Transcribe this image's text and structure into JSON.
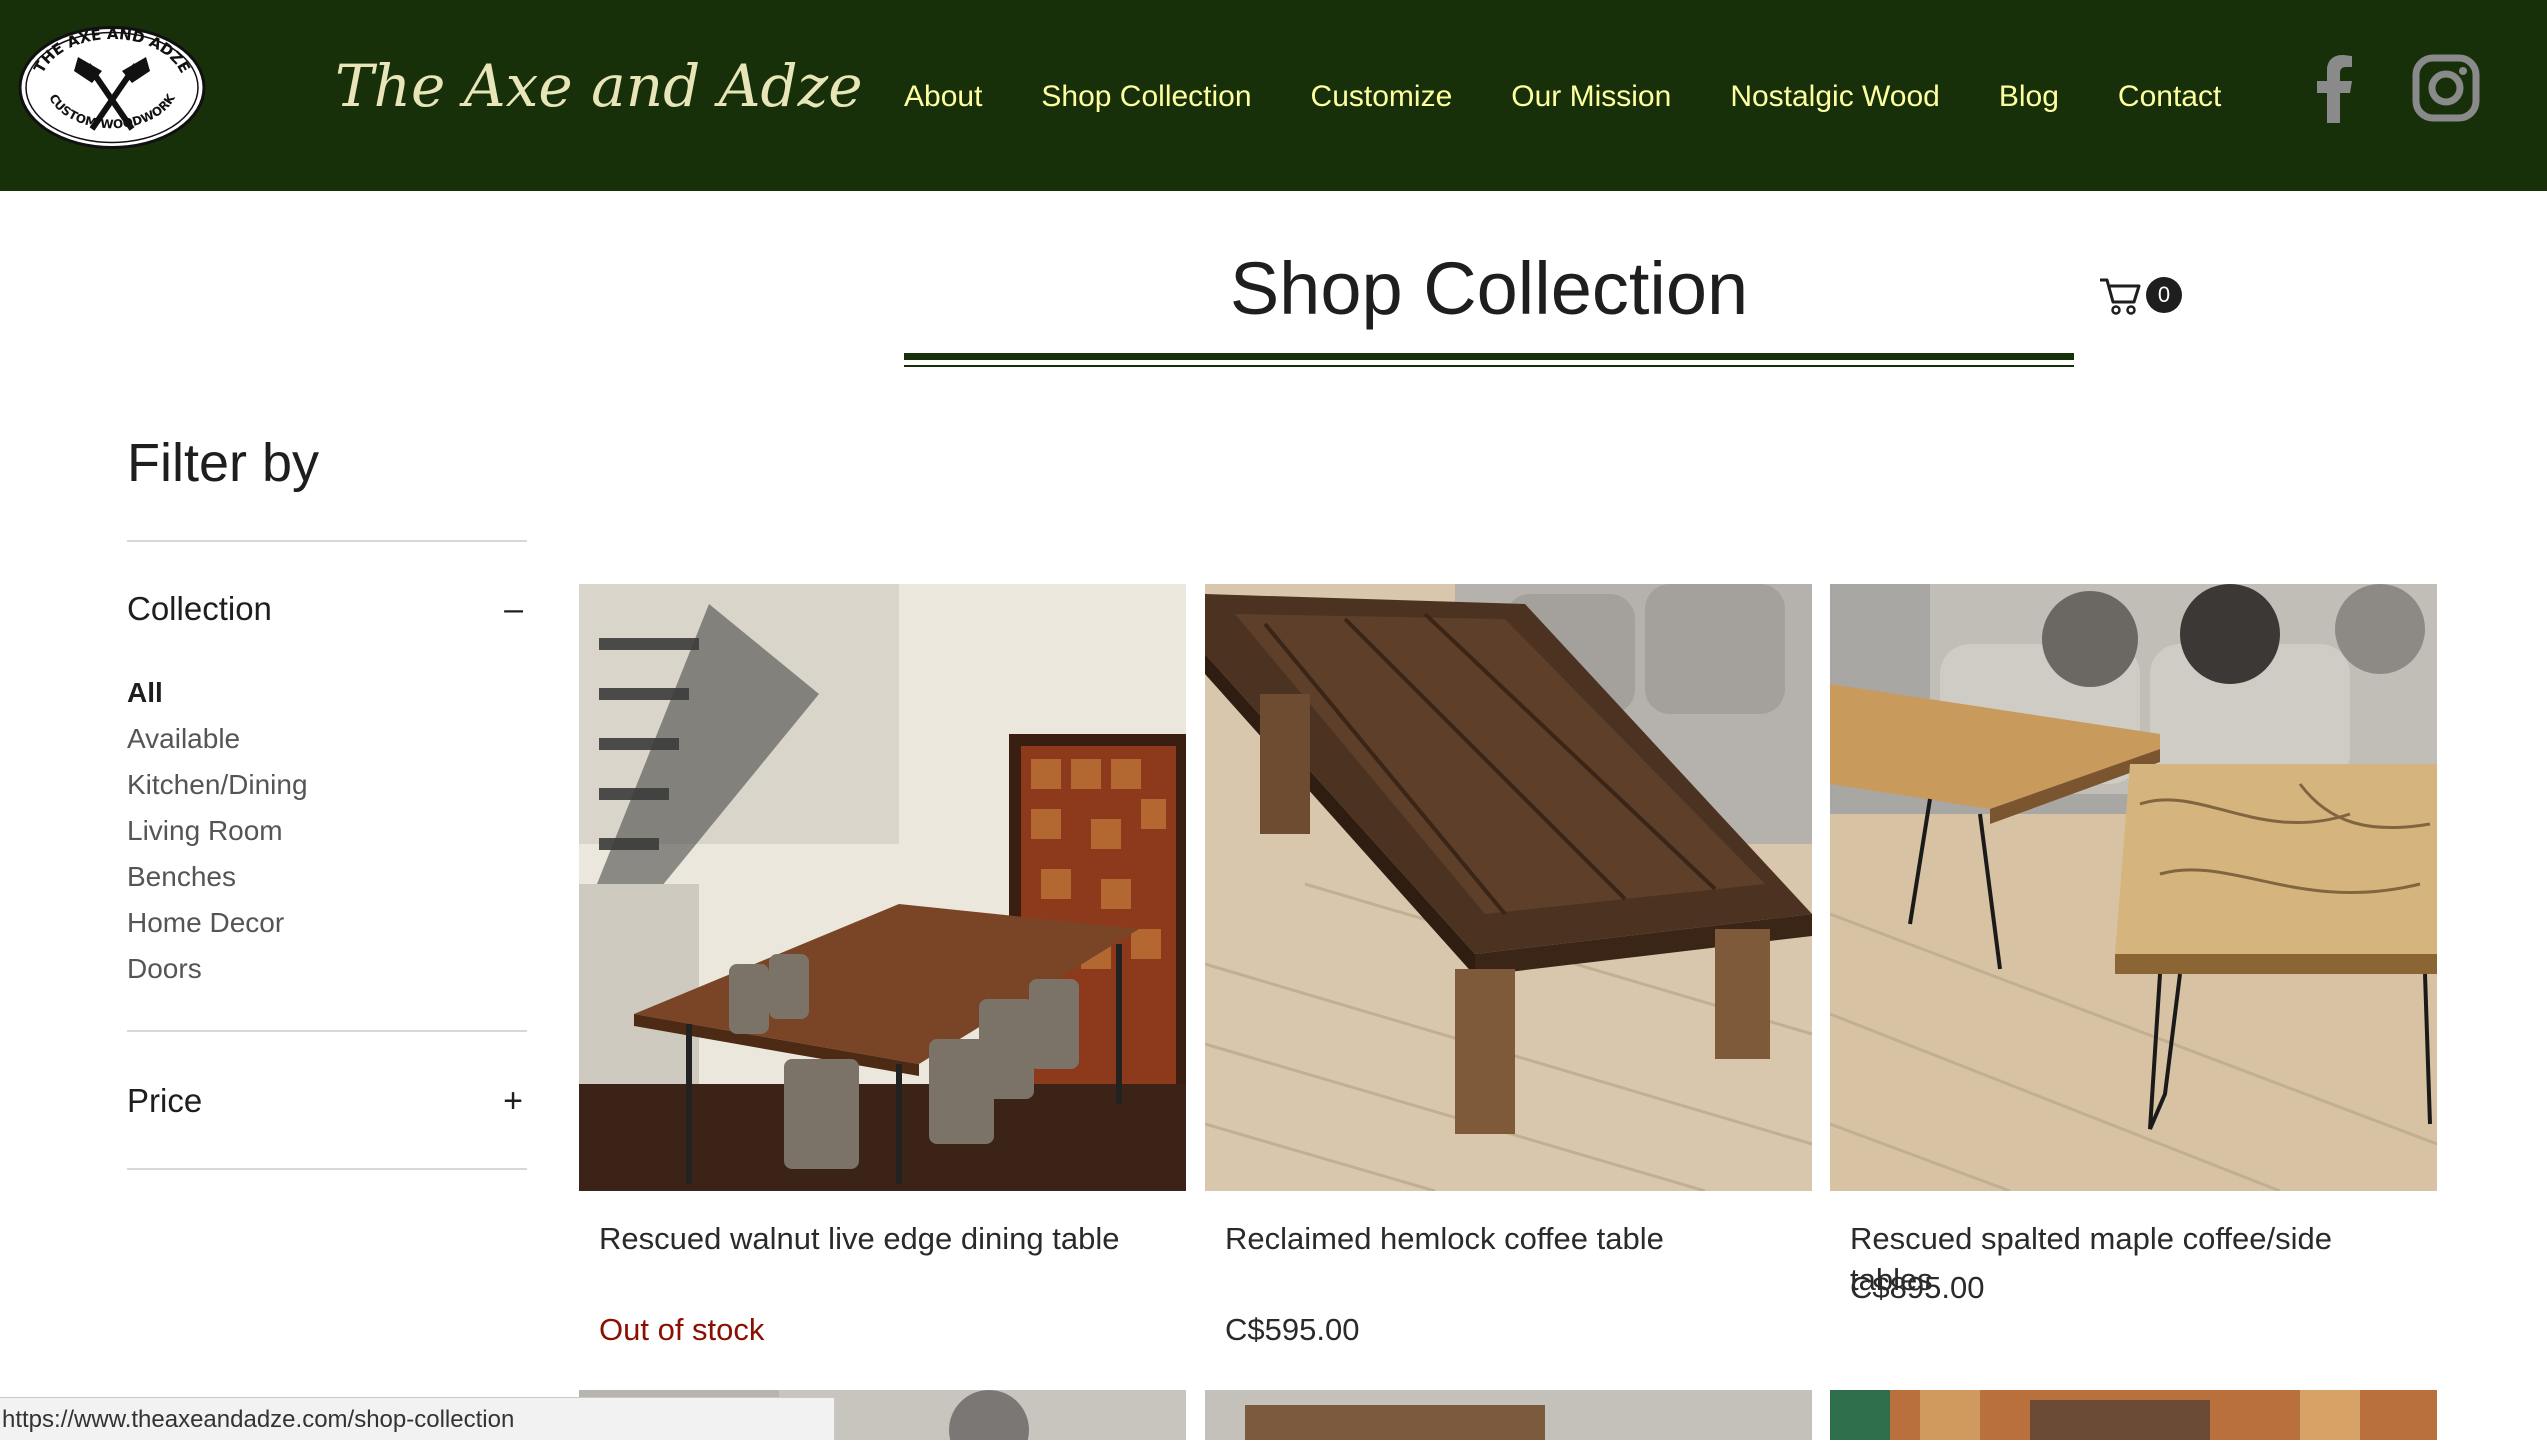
{
  "header": {
    "logo_text_top": "THE AXE AND ADZE",
    "logo_text_bottom": "CUSTOM WOODWORK",
    "brand": "The Axe and Adze",
    "nav": [
      "About",
      "Shop Collection",
      "Customize",
      "Our Mission",
      "Nostalgic Wood",
      "Blog",
      "Contact"
    ],
    "social_icons": [
      "facebook-icon",
      "instagram-icon"
    ]
  },
  "page": {
    "title": "Shop Collection",
    "cart_count": "0"
  },
  "filter": {
    "title": "Filter by",
    "collection": {
      "label": "Collection",
      "toggle": "–",
      "items": [
        "All",
        "Available",
        "Kitchen/Dining",
        "Living Room",
        "Benches",
        "Home Decor",
        "Doors"
      ],
      "selected": "All"
    },
    "price": {
      "label": "Price",
      "toggle": "+"
    }
  },
  "products": [
    {
      "name": "Rescued walnut live edge dining table",
      "price": "Out of stock"
    },
    {
      "name": "Reclaimed hemlock coffee table",
      "price": "C$595.00"
    },
    {
      "name": "Rescued spalted maple coffee/side tables",
      "price": "C$895.00"
    }
  ],
  "status_url": "https://www.theaxeandadze.com/shop-collection",
  "colors": {
    "header_bg": "#173009",
    "nav_text": "#ffffa0",
    "out_of_stock": "#8b0f00"
  }
}
